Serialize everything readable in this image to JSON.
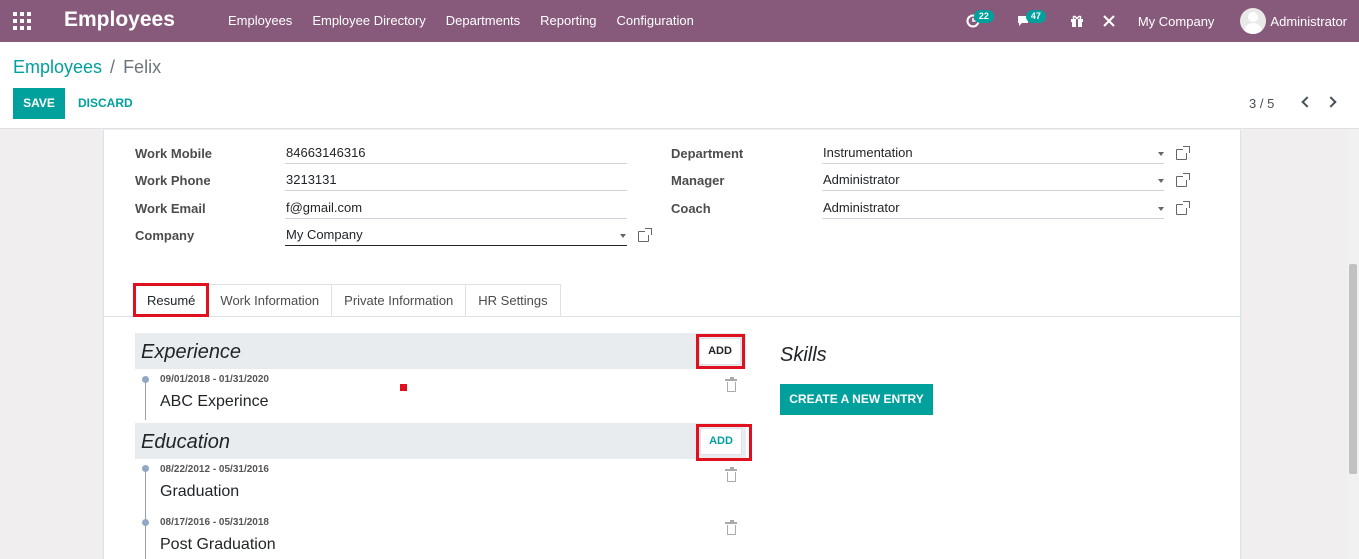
{
  "navbar": {
    "brand": "Employees",
    "menu": [
      "Employees",
      "Employee Directory",
      "Departments",
      "Reporting",
      "Configuration"
    ],
    "activities_count": "22",
    "messages_count": "47",
    "company": "My Company",
    "user": "Administrator",
    "color": "#875a7b"
  },
  "breadcrumb": {
    "parent": "Employees",
    "separator": "/",
    "current": "Felix"
  },
  "actions": {
    "save": "SAVE",
    "discard": "DISCARD"
  },
  "pager": {
    "value": "3 / 5"
  },
  "fields": {
    "work_mobile": {
      "label": "Work Mobile",
      "value": "84663146316"
    },
    "work_phone": {
      "label": "Work Phone",
      "value": "3213131"
    },
    "work_email": {
      "label": "Work Email",
      "value": "f@gmail.com"
    },
    "company": {
      "label": "Company",
      "value": "My Company"
    },
    "department": {
      "label": "Department",
      "value": "Instrumentation"
    },
    "manager": {
      "label": "Manager",
      "value": "Administrator"
    },
    "coach": {
      "label": "Coach",
      "value": "Administrator"
    }
  },
  "tabs": [
    "Resumé",
    "Work Information",
    "Private Information",
    "HR Settings"
  ],
  "resume": {
    "experience": {
      "title": "Experience",
      "add": "ADD",
      "entries": [
        {
          "date": "09/01/2018 - 01/31/2020",
          "name": "ABC Experince"
        }
      ]
    },
    "education": {
      "title": "Education",
      "add": "ADD",
      "entries": [
        {
          "date": "08/22/2012 - 05/31/2016",
          "name": "Graduation"
        },
        {
          "date": "08/17/2016 - 05/31/2018",
          "name": "Post Graduation"
        }
      ]
    }
  },
  "skills": {
    "title": "Skills",
    "create": "CREATE A NEW ENTRY"
  },
  "colors": {
    "accent": "#00a09d",
    "highlight": "#e0101f"
  }
}
